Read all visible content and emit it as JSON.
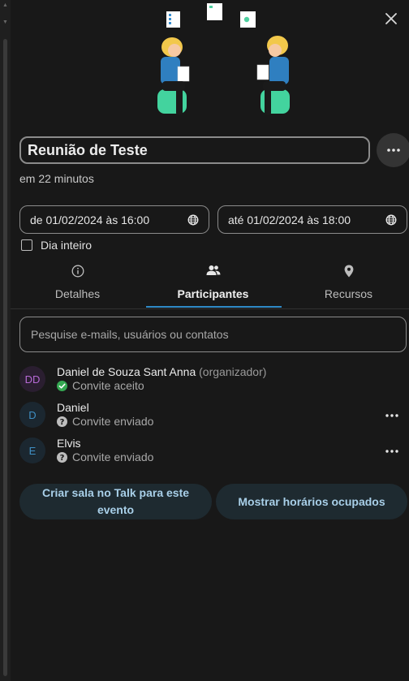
{
  "event": {
    "title": "Reunião de Teste",
    "countdown": "em 22 minutos",
    "start": "de 01/02/2024 às 16:00",
    "end": "até 01/02/2024 às 18:00",
    "all_day_label": "Dia inteiro",
    "all_day_checked": false
  },
  "tabs": [
    {
      "label": "Detalhes",
      "icon": "info-icon",
      "active": false
    },
    {
      "label": "Participantes",
      "icon": "people-icon",
      "active": true
    },
    {
      "label": "Recursos",
      "icon": "location-pin-icon",
      "active": false
    }
  ],
  "search": {
    "placeholder": "Pesquise e-mails, usuários ou contatos"
  },
  "attendees": [
    {
      "initials": "DD",
      "name": "Daniel de Souza Sant Anna",
      "role": "(organizador)",
      "status": "Convite aceito",
      "status_icon": "check-circle-icon",
      "avatar_color": "#b76ad6",
      "avatar_bg": "#2a1e30"
    },
    {
      "initials": "D",
      "name": "Daniel",
      "role": "",
      "status": "Convite enviado",
      "status_icon": "question-circle-icon",
      "avatar_color": "#3f8fc4",
      "avatar_bg": "#1b2730"
    },
    {
      "initials": "E",
      "name": "Elvis",
      "role": "",
      "status": "Convite enviado",
      "status_icon": "question-circle-icon",
      "avatar_color": "#3f8fc4",
      "avatar_bg": "#1b2730"
    }
  ],
  "actions": {
    "talk_room": "Criar sala no Talk para este evento",
    "busy_slots": "Mostrar horários ocupados"
  },
  "colors": {
    "background": "#181818",
    "accent": "#2f89c6",
    "success": "#35a852",
    "button_bg": "#1e2a30",
    "button_text": "#a8cfe8"
  }
}
